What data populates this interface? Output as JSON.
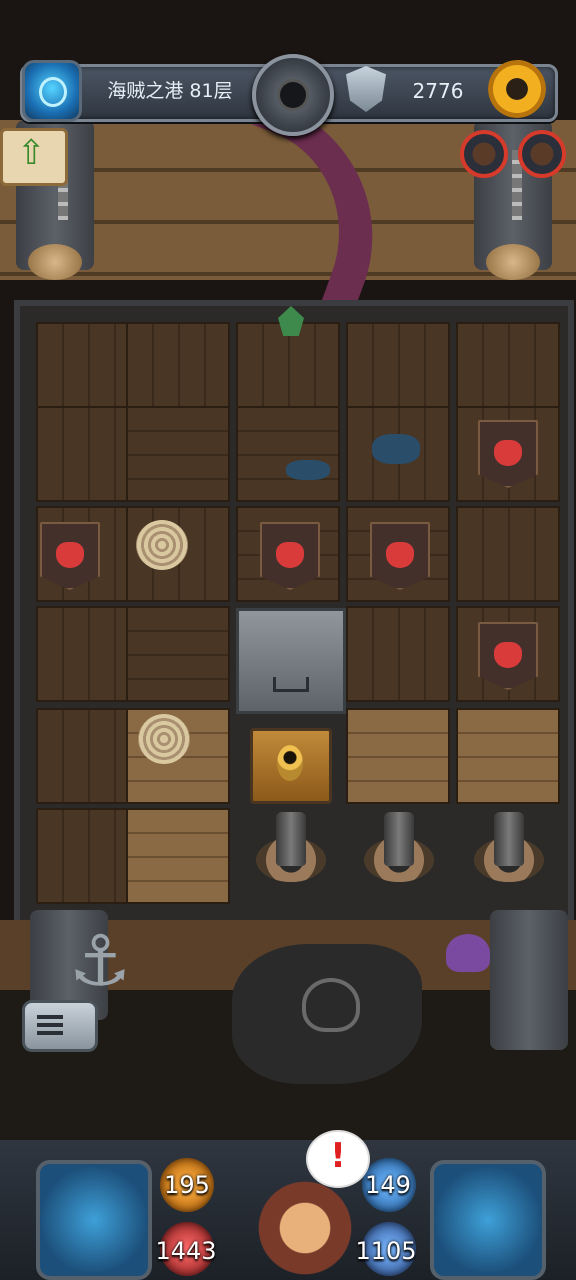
{
  "header": {
    "floor": "海贼之港 81层",
    "coins": "2776"
  },
  "stats": {
    "attack": "195",
    "defense": "149",
    "hp": "1443",
    "gold": "1105"
  },
  "icons": {
    "portal": "portal-icon",
    "bomb": "bomb-medallion-icon",
    "shield": "shield-icon",
    "settings": "gear-icon",
    "up": "up-arrow-icon",
    "menu": "menu-icon",
    "alert": "exclamation-icon"
  },
  "colors": {
    "accent": "#f2b021",
    "alert": "#e02020",
    "avatar_border": "#d63a2a"
  }
}
